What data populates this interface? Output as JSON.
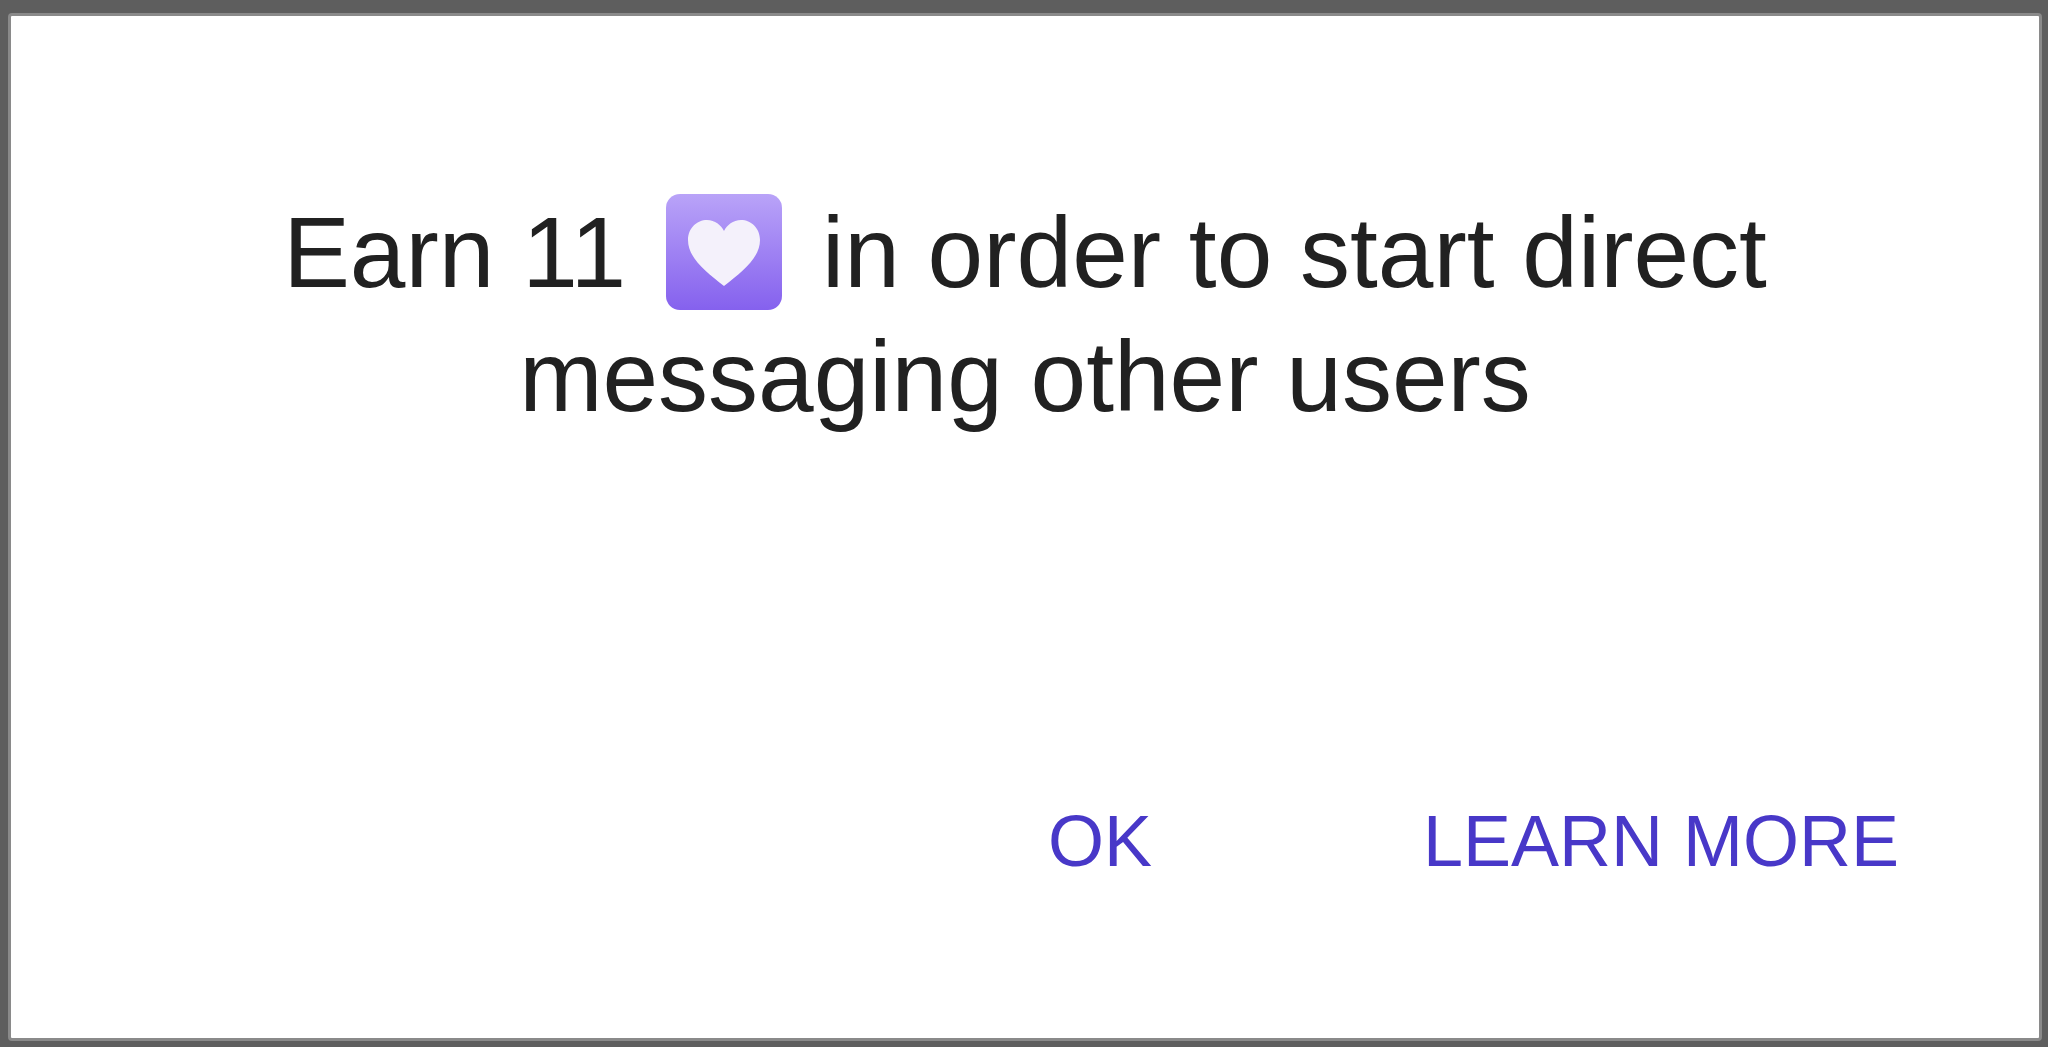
{
  "dialog": {
    "message": {
      "lines": [
        {
          "segments": [
            {
              "kind": "text",
              "text": "Earn 11"
            },
            {
              "kind": "icon"
            },
            {
              "kind": "text",
              "text": "in order to start direct"
            }
          ]
        },
        {
          "segments": [
            {
              "kind": "text",
              "text": "messaging other users"
            }
          ]
        }
      ]
    },
    "buttons": [
      {
        "label": "OK"
      },
      {
        "label": "LEARN MORE"
      }
    ]
  }
}
